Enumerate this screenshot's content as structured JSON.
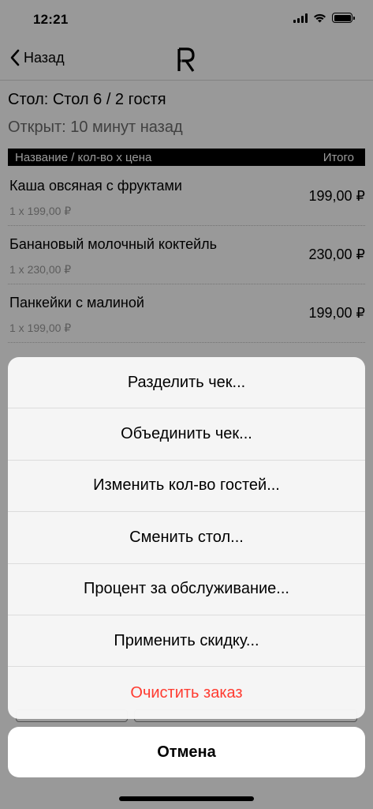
{
  "status_bar": {
    "time": "12:21"
  },
  "nav": {
    "back_label": "Назад"
  },
  "order": {
    "table_title": "Стол: Стол 6 / 2 гостя",
    "opened": "Открыт: 10 минут назад",
    "header": {
      "name_col": "Название / кол-во х цена",
      "total_col": "Итого"
    },
    "items": [
      {
        "name": "Каша овсяная с фруктами",
        "qty_price": "1 x 199,00 ₽",
        "total": "199,00 ₽"
      },
      {
        "name": "Банановый молочный коктейль",
        "qty_price": "1 x 230,00 ₽",
        "total": "230,00 ₽"
      },
      {
        "name": "Панкейки с малиной",
        "qty_price": "1 x 199,00 ₽",
        "total": "199,00 ₽"
      }
    ]
  },
  "action_sheet": {
    "actions": [
      {
        "label": "Разделить чек..."
      },
      {
        "label": "Объединить чек..."
      },
      {
        "label": "Изменить кол-во гостей..."
      },
      {
        "label": "Сменить стол..."
      },
      {
        "label": "Процент за обслуживание..."
      },
      {
        "label": "Применить скидку..."
      },
      {
        "label": "Очистить заказ"
      }
    ],
    "cancel_label": "Отмена",
    "destructive_color": "#ff3b30"
  }
}
